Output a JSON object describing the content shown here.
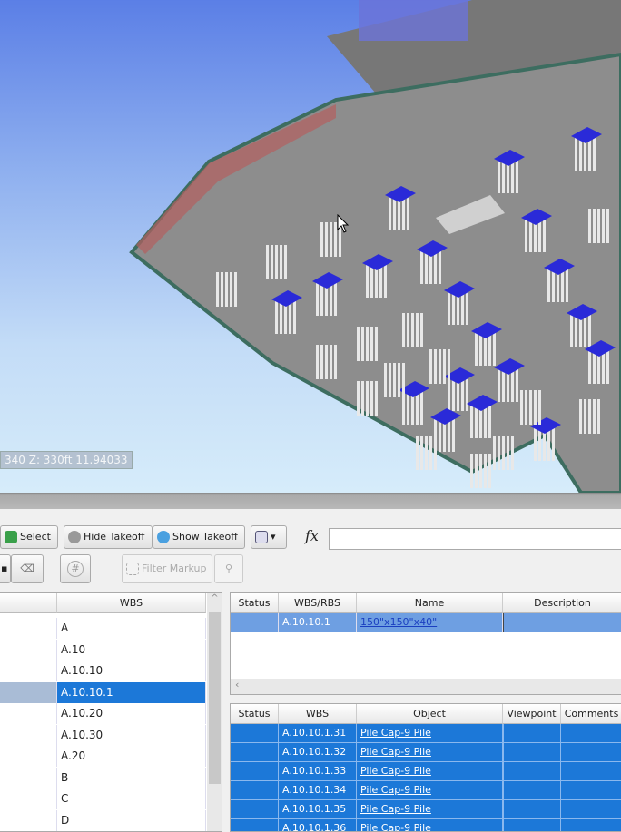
{
  "viewport": {
    "coordinate_readout": "340  Z: 330ft 11.94033",
    "sky_color": "#7fa4ec",
    "slab_color": "#8a8a8a",
    "pile_cap_color": "#2a2ad8"
  },
  "toolbar": {
    "select_label": "Select",
    "hide_takeoff_label": "Hide Takeoff",
    "show_takeoff_label": "Show Takeoff",
    "fx_label": "fx",
    "formula_value": "",
    "filter_markup_label": "Filter Markup"
  },
  "wbs_tree": {
    "header": "WBS",
    "items": [
      "A",
      "A.10",
      "A.10.10",
      "A.10.10.1",
      "A.10.20",
      "A.10.30",
      "A.20",
      "B",
      "C",
      "D"
    ],
    "selected": "A.10.10.1"
  },
  "takeoff_grid": {
    "headers": [
      "Status",
      "WBS/RBS",
      "Name",
      "Description"
    ],
    "rows": [
      {
        "status": "",
        "wbs": "A.10.10.1",
        "name": "150\"x150\"x40\"",
        "description": ""
      }
    ]
  },
  "object_grid": {
    "headers": [
      "Status",
      "WBS",
      "Object",
      "Viewpoint",
      "Comments"
    ],
    "rows": [
      {
        "wbs": "A.10.10.1.31",
        "object": "Pile Cap-9 Pile"
      },
      {
        "wbs": "A.10.10.1.32",
        "object": "Pile Cap-9 Pile"
      },
      {
        "wbs": "A.10.10.1.33",
        "object": "Pile Cap-9 Pile"
      },
      {
        "wbs": "A.10.10.1.34",
        "object": "Pile Cap-9 Pile"
      },
      {
        "wbs": "A.10.10.1.35",
        "object": "Pile Cap-9 Pile"
      },
      {
        "wbs": "A.10.10.1.36",
        "object": "Pile Cap-9 Pile"
      }
    ]
  },
  "colors": {
    "selection": "#1c78d8",
    "selection_light": "#6e9fe2"
  }
}
